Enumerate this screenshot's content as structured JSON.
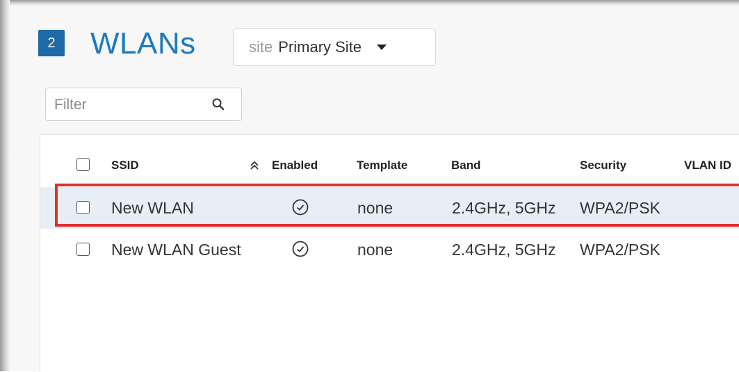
{
  "header": {
    "count": "2",
    "title": "WLANs",
    "site_selector": {
      "prefix": "site",
      "value": "Primary Site"
    }
  },
  "filter": {
    "placeholder": "Filter",
    "value": ""
  },
  "table": {
    "columns": [
      {
        "key": "ssid",
        "label": "SSID"
      },
      {
        "key": "enabled",
        "label": "Enabled"
      },
      {
        "key": "template",
        "label": "Template"
      },
      {
        "key": "band",
        "label": "Band"
      },
      {
        "key": "security",
        "label": "Security"
      },
      {
        "key": "vlan_id",
        "label": "VLAN ID"
      }
    ],
    "rows": [
      {
        "ssid": "New WLAN",
        "enabled": true,
        "template": "none",
        "band": "2.4GHz, 5GHz",
        "security": "WPA2/PSK",
        "vlan_id": "",
        "selected": true
      },
      {
        "ssid": "New WLAN Guest",
        "enabled": true,
        "template": "none",
        "band": "2.4GHz, 5GHz",
        "security": "WPA2/PSK",
        "vlan_id": "",
        "selected": false
      }
    ]
  },
  "colors": {
    "accent": "#1d7ac0",
    "badge": "#1d6aa8",
    "highlight": "#e0312b",
    "selected_row": "#e8eef5"
  },
  "icons": {
    "search": "search-icon",
    "dropdown": "caret-down-icon",
    "sort": "sort-ascending-icon",
    "enabled": "check-circle-icon"
  }
}
